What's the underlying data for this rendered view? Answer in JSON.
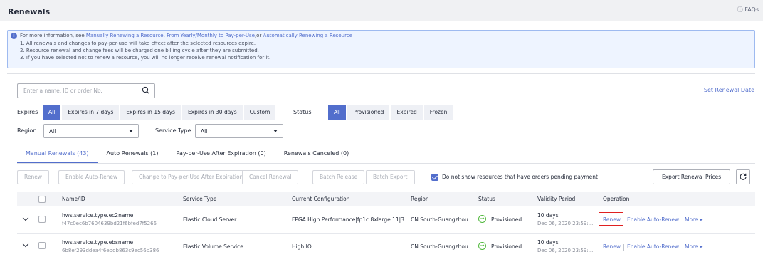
{
  "header": {
    "title": "Renewals",
    "faqs": "FAQs"
  },
  "info": {
    "prefix": "For more information, see ",
    "link1": "Manually Renewing a Resource",
    "sep1": ", ",
    "link2": "From Yearly/Monthly to Pay-per-Use",
    "sep2": ",or ",
    "link3": "Automatically Renewing a Resource",
    "lines": [
      "1. All renewals and changes to pay-per-use will take effect after the selected resources expire.",
      "2. Resource renewal and change fees will be charged one billing cycle after they are submitted.",
      "3. If you have selected not to renew a resource, you will no longer receive renewal notification for it."
    ]
  },
  "search": {
    "placeholder": "Enter a name, ID or order No."
  },
  "set_renewal_date": "Set Renewal Date",
  "filters": {
    "expires_label": "Expires",
    "expires_options": [
      "All",
      "Expires in 7 days",
      "Expires in 15 days",
      "Expires in 30 days",
      "Custom"
    ],
    "expires_selected": "All",
    "status_label": "Status",
    "status_options": [
      "All",
      "Provisioned",
      "Expired",
      "Frozen"
    ],
    "status_selected": "All",
    "region_label": "Region",
    "region_value": "All",
    "service_type_label": "Service Type",
    "service_type_value": "All"
  },
  "tabs": [
    {
      "label": "Manual Renewals (43)",
      "active": true
    },
    {
      "label": "Auto Renewals (1)",
      "active": false
    },
    {
      "label": "Pay-per-Use After Expiration (0)",
      "active": false
    },
    {
      "label": "Renewals Canceled (0)",
      "active": false
    }
  ],
  "toolbar": {
    "renew": "Renew",
    "enable_auto_renew": "Enable Auto-Renew",
    "change_ppu": "Change to Pay-per-Use After Expiration",
    "cancel_renewal": "Cancel Renewal",
    "batch_release": "Batch Release",
    "batch_export": "Batch Export",
    "pending_checkbox_label": "Do not show resources that have orders pending payment",
    "pending_checked": true,
    "export_prices": "Export Renewal Prices",
    "refresh_icon": "refresh-icon"
  },
  "table": {
    "columns": [
      "Name/ID",
      "Service Type",
      "Current Configuration",
      "Region",
      "Status",
      "Validity Period",
      "Operation"
    ],
    "rows": [
      {
        "name": "hws.service.type.ec2name",
        "id": "f47c0ec6b7604639bd21f6bfed7f5266",
        "service_type": "Elastic Cloud Server",
        "configuration": "FPGA High Performance|fp1c.8xlarge.11|3...",
        "region": "CN South-Guangzhou",
        "status": "Provisioned",
        "validity": "10 days",
        "validity_date": "Dec 06, 2020 23:59:...",
        "ops": [
          "Renew",
          "Enable Auto-Renew",
          "More"
        ]
      },
      {
        "name": "hws.service.type.ebsname",
        "id": "6b8ef293ddea4f6ebdb863c9ec56b386",
        "service_type": "Elastic Volume Service",
        "configuration": "High IO",
        "region": "CN South-Guangzhou",
        "status": "Provisioned",
        "validity": "10 days",
        "validity_date": "Dec 06, 2020 23:59:...",
        "ops": [
          "Renew",
          "Enable Auto-Renew",
          "More"
        ]
      }
    ]
  },
  "colors": {
    "accent": "#526ecc",
    "status_ok": "#50b83c",
    "highlight": "#e02020"
  }
}
